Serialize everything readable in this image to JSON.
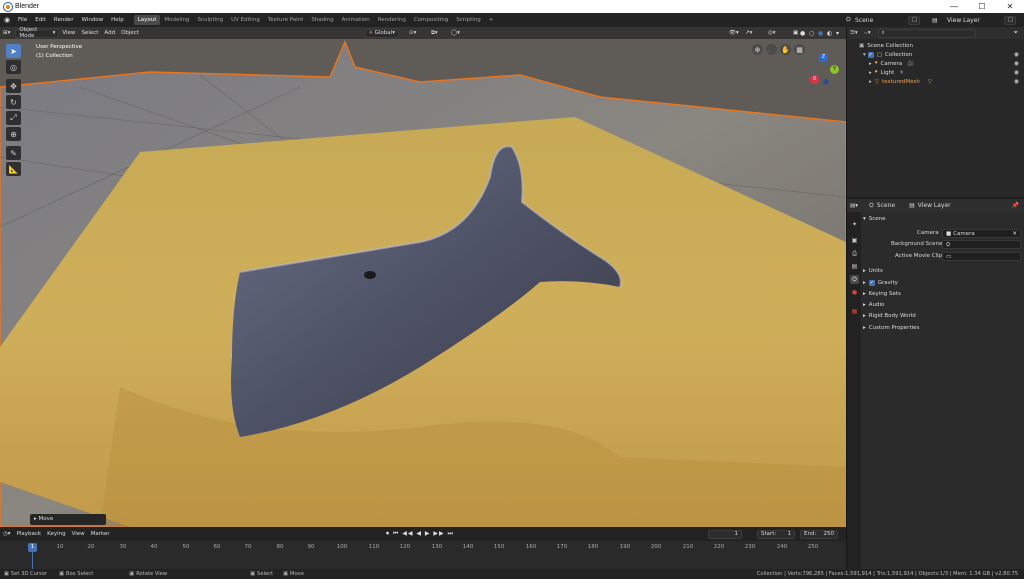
{
  "window": {
    "title": "Blender"
  },
  "menus": [
    "File",
    "Edit",
    "Render",
    "Window",
    "Help"
  ],
  "workspaces": [
    "Layout",
    "Modeling",
    "Sculpting",
    "UV Editing",
    "Texture Paint",
    "Shading",
    "Animation",
    "Rendering",
    "Compositing",
    "Scripting"
  ],
  "active_workspace": "Layout",
  "add_workspace": "+",
  "scene_field": "Scene",
  "view_layer_field": "View Layer",
  "viewport": {
    "mode": "Object Mode",
    "header_menus": [
      "View",
      "Select",
      "Add",
      "Object"
    ],
    "transform": "Global",
    "overlay_title": "User Perspective",
    "overlay_sub": "(1) Collection",
    "last_op": "Move",
    "gizmo_axes": {
      "x": "X",
      "y": "Y",
      "z": "Z"
    }
  },
  "colors": {
    "accent": "#4772b3",
    "selected_orange": "#e87d0d",
    "active_tab": "#5180c5"
  },
  "timeline": {
    "menus": [
      "Playback",
      "Keying",
      "View",
      "Marker"
    ],
    "current_frame": "1",
    "start_label": "Start:",
    "start": "1",
    "end_label": "End:",
    "end": "250",
    "ruler": [
      "1",
      "10",
      "20",
      "30",
      "40",
      "50",
      "60",
      "70",
      "80",
      "90",
      "100",
      "110",
      "120",
      "130",
      "140",
      "150",
      "160",
      "170",
      "180",
      "190",
      "200",
      "210",
      "220",
      "230",
      "240",
      "250"
    ]
  },
  "outliner": {
    "root": "Scene Collection",
    "collection": "Collection",
    "items": [
      {
        "name": "Camera",
        "color": "#e0e0e0"
      },
      {
        "name": "Light",
        "color": "#e0e0e0"
      },
      {
        "name": "texturedMesh",
        "color": "#e8a15a"
      }
    ]
  },
  "properties": {
    "tab_scene": "Scene",
    "tab_view_layer": "View Layer",
    "section": "Scene",
    "camera_label": "Camera",
    "camera_value": "Camera",
    "background_label": "Background Scene",
    "movie_label": "Active Movie Clip",
    "units": "Units",
    "gravity": "Gravity",
    "keying_sets": "Keying Sets",
    "audio": "Audio",
    "rigid_body": "Rigid Body World",
    "custom_props": "Custom Properties"
  },
  "status": {
    "left": [
      "Set 3D Cursor",
      "Box Select",
      "Rotate View",
      "Select",
      "Move"
    ],
    "right": "Collection | Verts:796,285 | Faces:1,591,914 | Tris:1,591,914 | Objects:1/3 | Mem: 1.34 GB | v2.80.75"
  }
}
